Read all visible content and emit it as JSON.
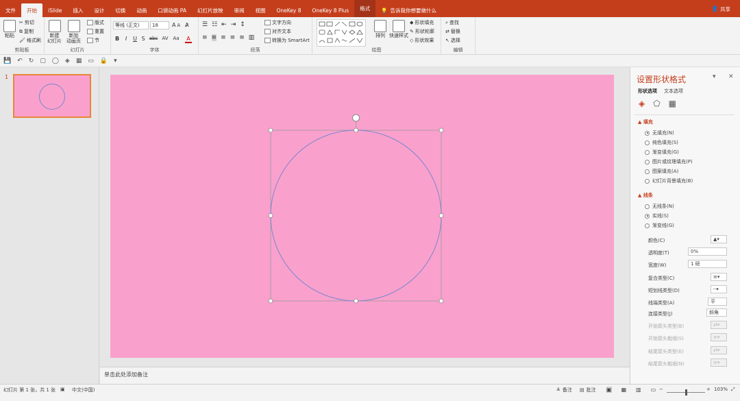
{
  "tabs": {
    "file": "文件",
    "home": "开始",
    "islide": "iSlide",
    "insert": "插入",
    "design": "设计",
    "transitions": "切换",
    "animations": "动画",
    "pocket_animation": "口袋动画 PA",
    "slideshow": "幻灯片放映",
    "review": "审阅",
    "view": "视图",
    "onekey8": "OneKey 8",
    "onekey8plus": "OneKey 8 Plus",
    "format": "格式"
  },
  "tell_me": "告诉我你想要做什么",
  "share": "共享",
  "ribbon": {
    "clipboard": {
      "paste": "粘贴",
      "cut": "剪切",
      "copy": "复制",
      "format_painter": "格式刷",
      "label": "剪贴板"
    },
    "slides": {
      "new_slide": "新建\n幻灯片",
      "new_anim_slide": "新加\n动画页",
      "layout": "版式",
      "reset": "重置",
      "section": "节",
      "label": "幻灯片"
    },
    "font": {
      "font_name": "等线 (正文)",
      "font_size": "18",
      "bold": "B",
      "italic": "I",
      "underline": "U",
      "shadow": "S",
      "strike": "abc",
      "spacing": "AV",
      "case": "Aa",
      "color": "A",
      "label": "字体"
    },
    "paragraph": {
      "text_direction": "文字方向",
      "align_text": "对齐文本",
      "smartart": "转换为 SmartArt",
      "label": "段落"
    },
    "drawing": {
      "arrange": "排列",
      "quick_styles": "快速样式",
      "shape_fill": "形状填充",
      "shape_outline": "形状轮廓",
      "shape_effects": "形状效果",
      "label": "绘图"
    },
    "editing": {
      "find": "查找",
      "replace": "替换",
      "select": "选择",
      "label": "编辑"
    }
  },
  "slide_panel": {
    "slide_number": "1"
  },
  "notes_placeholder": "单击此处添加备注",
  "format_pane": {
    "title": "设置形状格式",
    "tab_shape": "形状选项",
    "tab_text": "文本选项",
    "fill_section": "填充",
    "fill_options": [
      "无填充(N)",
      "纯色填充(S)",
      "渐变填充(G)",
      "图片或纹理填充(P)",
      "图案填充(A)",
      "幻灯片背景填充(B)"
    ],
    "fill_selected": 0,
    "line_section": "线条",
    "line_options": [
      "无线条(N)",
      "实线(S)",
      "渐变线(G)"
    ],
    "line_selected": 1,
    "color_label": "颜色(C)",
    "transparency_label": "透明度(T)",
    "transparency_value": "0%",
    "width_label": "宽度(W)",
    "width_value": "1 磅",
    "compound_label": "复合类型(C)",
    "dash_label": "短划线类型(D)",
    "cap_label": "线端类型(A)",
    "cap_value": "平",
    "join_label": "连接类型(J)",
    "join_value": "斜角",
    "begin_arrow_type": "开始箭头类型(B)",
    "begin_arrow_size": "开始箭头粗细(S)",
    "end_arrow_type": "结尾箭头类型(E)",
    "end_arrow_size": "结尾箭头粗细(N)"
  },
  "status": {
    "slide_info": "幻灯片 第 1 张，共 1 张",
    "language": "中文(中国)",
    "notes": "备注",
    "comments": "批注",
    "zoom": "103%"
  },
  "colors": {
    "accent": "#c43e1c",
    "slide_bg": "#f9a1cc",
    "circle_stroke": "#7a86cf"
  }
}
